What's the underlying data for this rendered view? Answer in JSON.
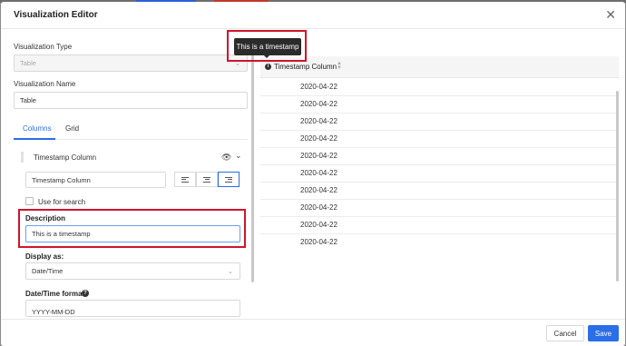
{
  "modal": {
    "title": "Visualization Editor"
  },
  "form": {
    "viz_type_label": "Visualization Type",
    "viz_type_value": "Table",
    "viz_name_label": "Visualization Name",
    "viz_name_value": "Table",
    "tabs": [
      {
        "label": "Columns",
        "active": true
      },
      {
        "label": "Grid",
        "active": false
      }
    ],
    "column": {
      "title": "Timestamp Column",
      "title_input_value": "Timestamp Column",
      "alignment": "right",
      "use_for_search_label": "Use for search",
      "use_for_search_checked": false,
      "description_label": "Description",
      "description_value": "This is a timestamp",
      "display_as_label": "Display as:",
      "display_as_value": "Date/Time",
      "datetime_format_label": "Date/Time format",
      "datetime_format_value": "YYYY-MM-DD"
    }
  },
  "preview": {
    "tooltip": "This is a timestamp",
    "column_header": "Timestamp Column",
    "rows": [
      "2020-04-22",
      "2020-04-22",
      "2020-04-22",
      "2020-04-22",
      "2020-04-22",
      "2020-04-22",
      "2020-04-22",
      "2020-04-22",
      "2020-04-22",
      "2020-04-22"
    ]
  },
  "footer": {
    "cancel_label": "Cancel",
    "save_label": "Save"
  },
  "colors": {
    "accent": "#2a6ee8",
    "highlight": "#d0142c"
  }
}
